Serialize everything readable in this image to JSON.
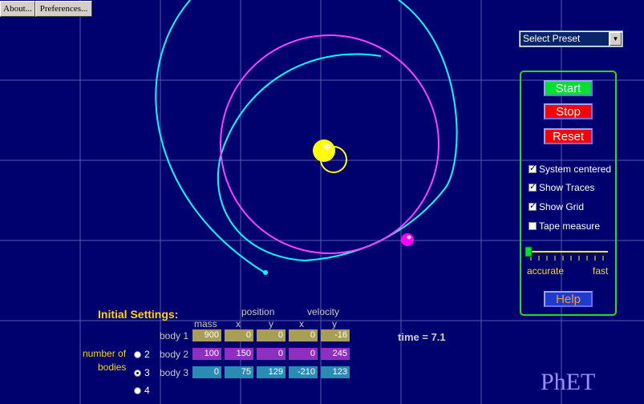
{
  "menu": {
    "about": "About...",
    "preferences": "Preferences..."
  },
  "preset": {
    "selected": "Select Preset"
  },
  "controls": {
    "start": "Start",
    "stop": "Stop",
    "reset": "Reset",
    "help": "Help",
    "system_centered": {
      "label": "System centered",
      "checked": true
    },
    "show_traces": {
      "label": "Show Traces",
      "checked": true
    },
    "show_grid": {
      "label": "Show Grid",
      "checked": true
    },
    "tape_measure": {
      "label": "Tape measure",
      "checked": false
    },
    "speed_accurate": "accurate",
    "speed_fast": "fast"
  },
  "settings": {
    "title": "Initial Settings:",
    "mass_header": "mass",
    "position_header": "position",
    "velocity_header": "velocity",
    "x_header": "x",
    "y_header": "y",
    "number_of_bodies_line1": "number of",
    "number_of_bodies_line2": "bodies",
    "radio_options": [
      "2",
      "3",
      "4"
    ],
    "selected_bodies": "3",
    "bodies": [
      {
        "label": "body 1",
        "mass": "900",
        "pos_x": "0",
        "pos_y": "0",
        "vel_x": "0",
        "vel_y": "-16"
      },
      {
        "label": "body 2",
        "mass": "100",
        "pos_x": "150",
        "pos_y": "0",
        "vel_x": "0",
        "vel_y": "245"
      },
      {
        "label": "body 3",
        "mass": "0",
        "pos_x": "75",
        "pos_y": "129",
        "vel_x": "-210",
        "vel_y": "123"
      }
    ]
  },
  "time": {
    "label": "time =",
    "value": "7.1"
  },
  "logo": "PhET",
  "colors": {
    "background": "#00006e",
    "grid": "#5a5ab4",
    "body1": "#ffff00",
    "body2": "#ff00ff",
    "body3": "#00ffff",
    "start": "#00e030",
    "stop": "#ff0000",
    "help": "#1a3cd0"
  }
}
